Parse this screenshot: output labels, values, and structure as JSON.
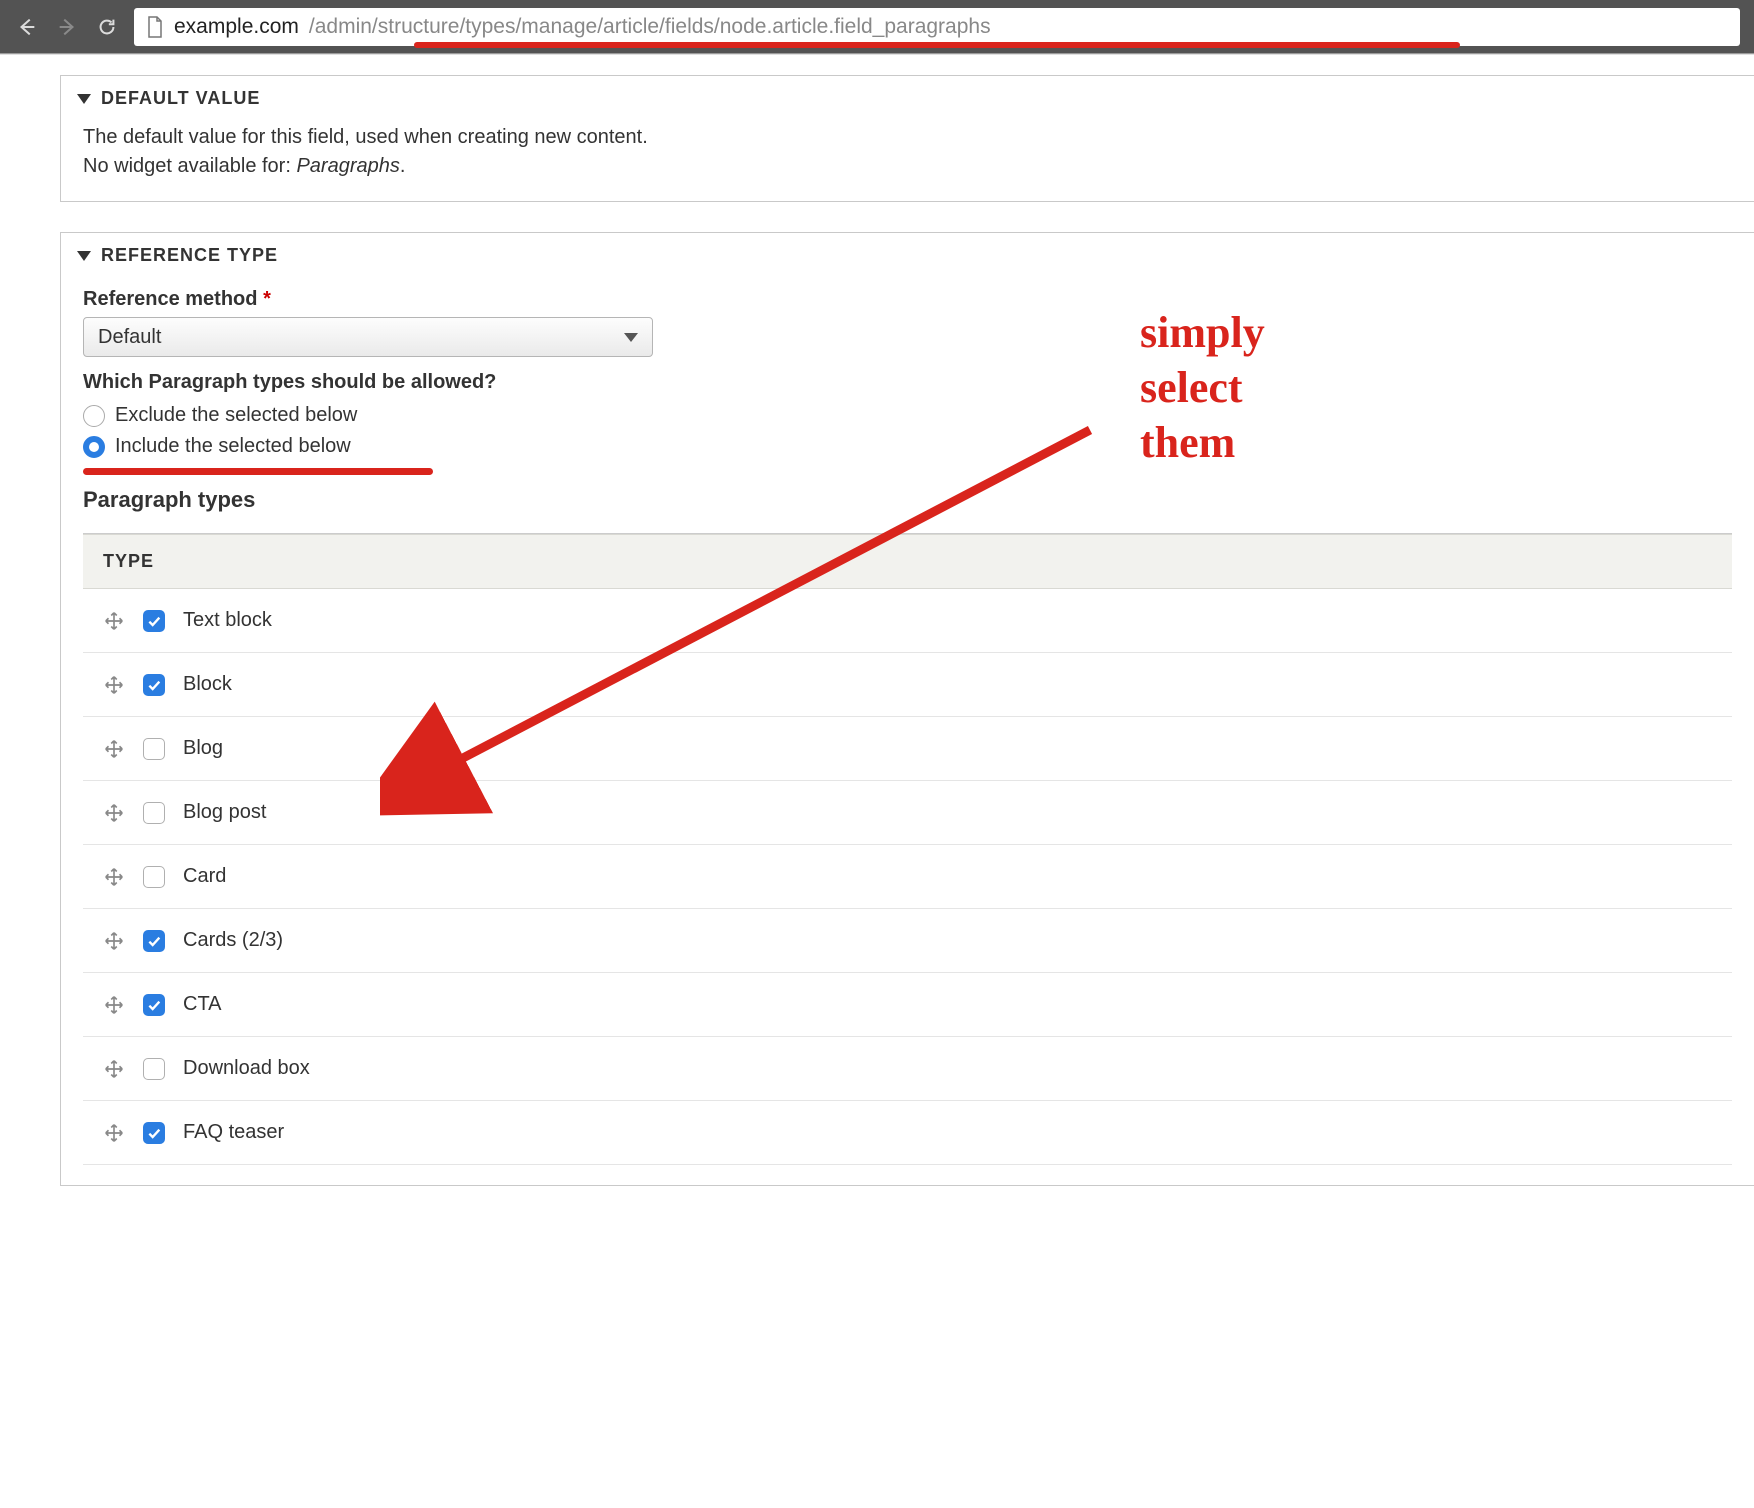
{
  "browser": {
    "url_host": "example.com",
    "url_path": "/admin/structure/types/manage/article/fields/node.article.field_paragraphs"
  },
  "sections": {
    "default_value": {
      "title": "DEFAULT VALUE",
      "line1": "The default value for this field, used when creating new content.",
      "line2_prefix": "No widget available for: ",
      "line2_em": "Paragraphs",
      "line2_suffix": "."
    },
    "reference_type": {
      "title": "REFERENCE TYPE",
      "method_label": "Reference method",
      "method_value": "Default",
      "allow_question": "Which Paragraph types should be allowed?",
      "radio_exclude": "Exclude the selected below",
      "radio_include": "Include the selected below",
      "radio_selected": "include",
      "ptypes_label": "Paragraph types",
      "table_header": "TYPE",
      "rows": [
        {
          "label": "Text block",
          "checked": true
        },
        {
          "label": "Block",
          "checked": true
        },
        {
          "label": "Blog",
          "checked": false
        },
        {
          "label": "Blog post",
          "checked": false
        },
        {
          "label": "Card",
          "checked": false
        },
        {
          "label": "Cards (2/3)",
          "checked": true
        },
        {
          "label": "CTA",
          "checked": true
        },
        {
          "label": "Download box",
          "checked": false
        },
        {
          "label": "FAQ teaser",
          "checked": true
        }
      ]
    }
  },
  "annotation": {
    "line1": "simply",
    "line2": "select",
    "line3": "them"
  },
  "colors": {
    "accent_red": "#d9241c",
    "accent_blue": "#2a7de1"
  }
}
